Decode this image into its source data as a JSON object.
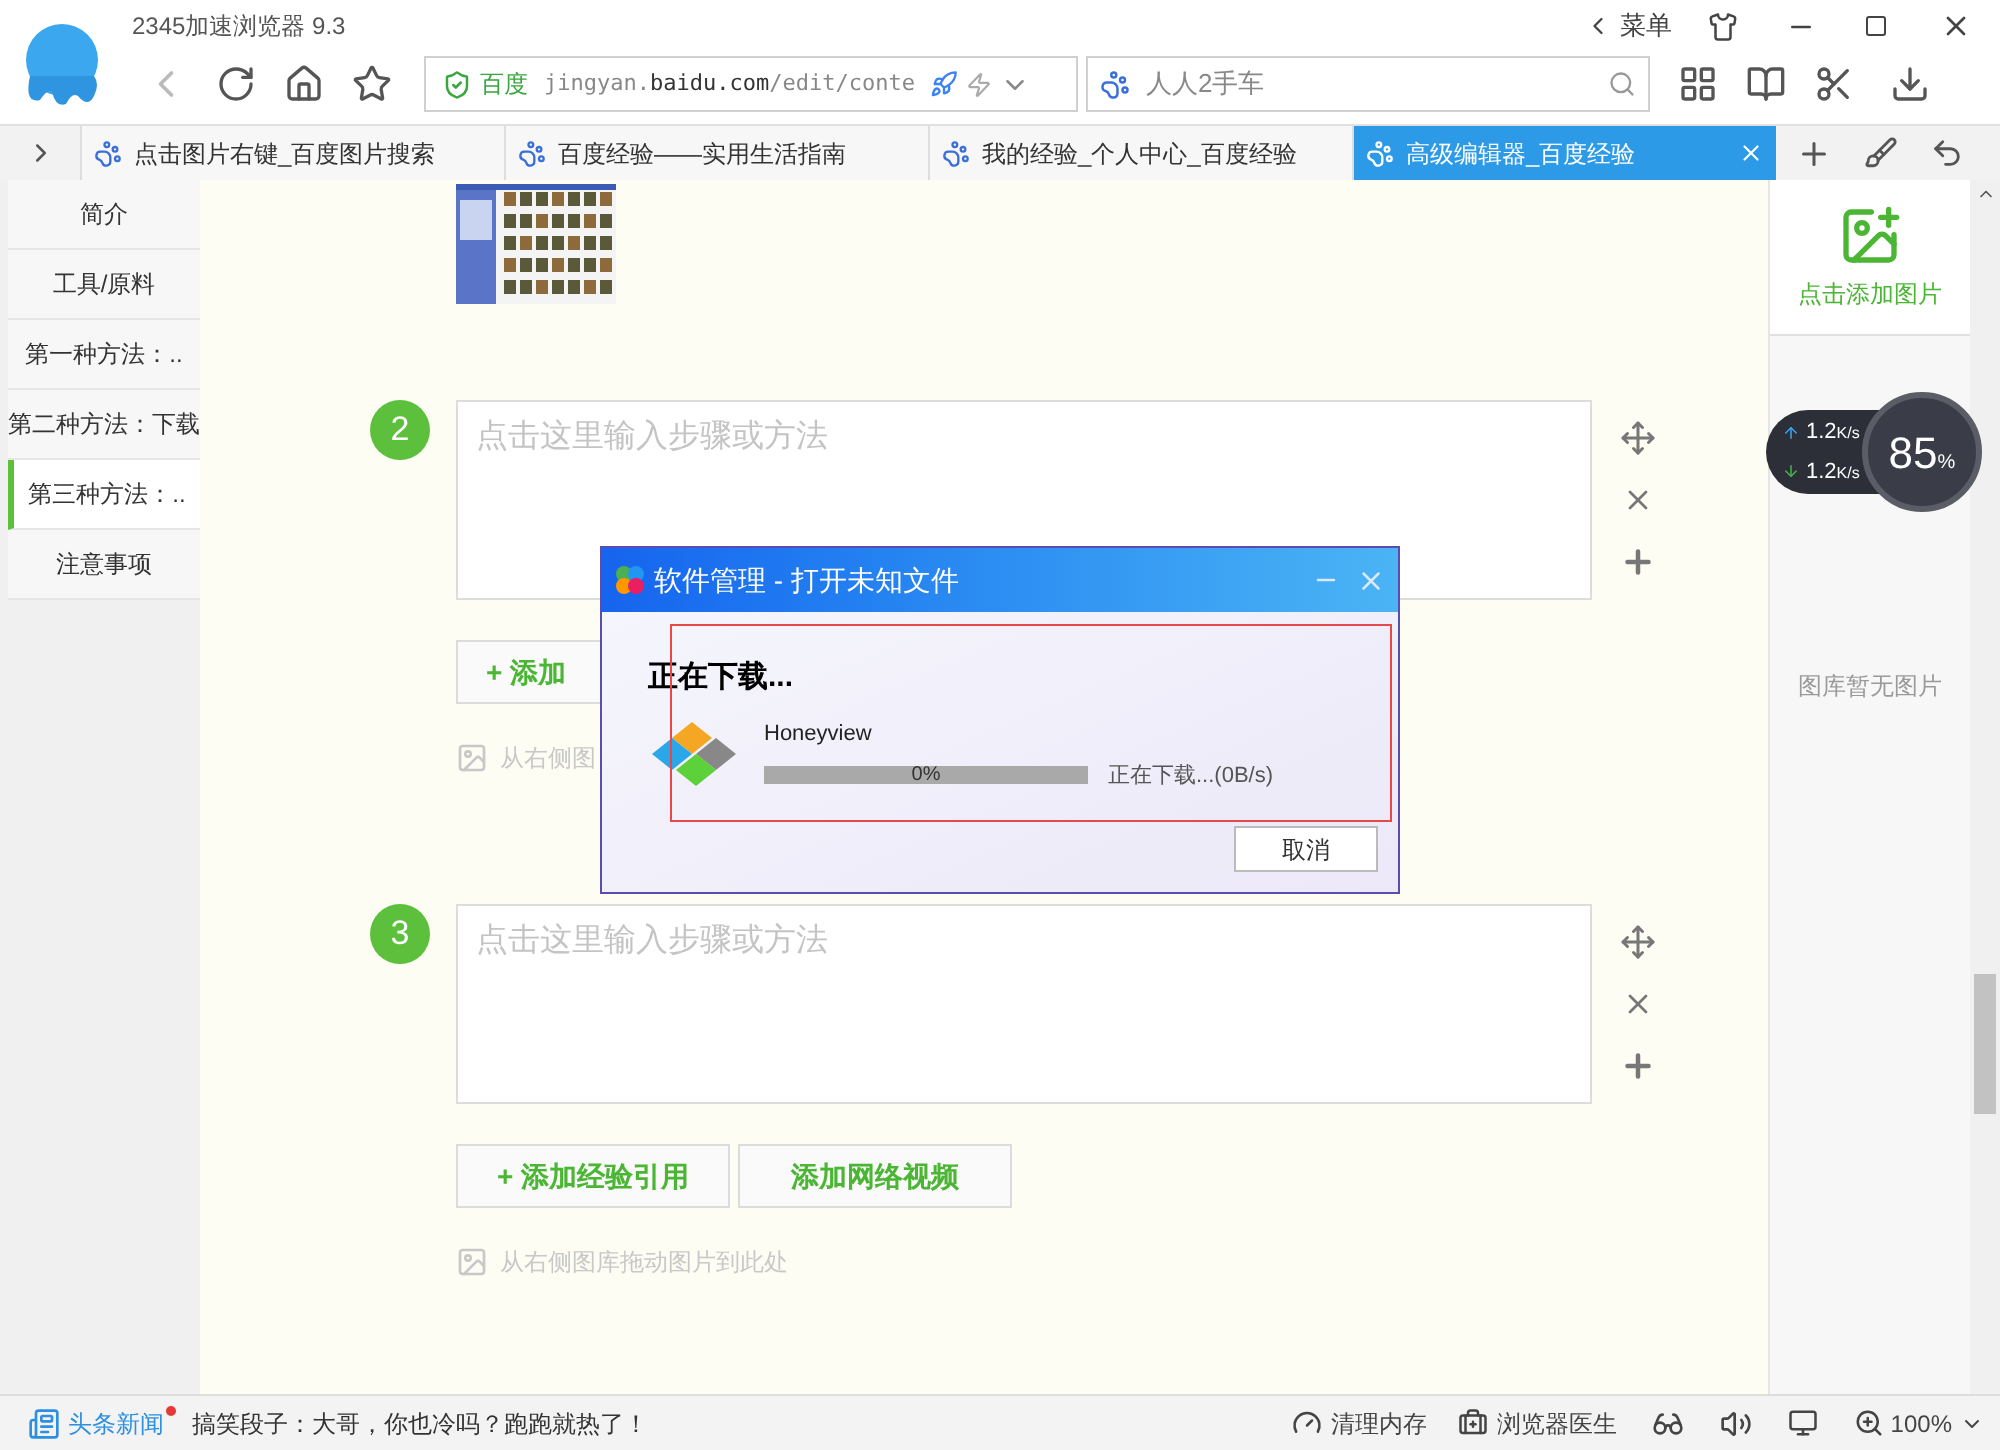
{
  "browser": {
    "title": "2345加速浏览器 9.3",
    "menu": "菜单",
    "address": {
      "site": "百度",
      "url": "jingyan.**baidu.com**/edit/conte"
    },
    "search": {
      "placeholder": "人人2手车"
    }
  },
  "tabs": [
    {
      "label": "点击图片右键_百度图片搜索",
      "selected": false
    },
    {
      "label": "百度经验——实用生活指南",
      "selected": false
    },
    {
      "label": "我的经验_个人中心_百度经验",
      "selected": false
    },
    {
      "label": "高级编辑器_百度经验",
      "selected": true
    }
  ],
  "sidebar": {
    "items": [
      {
        "label": "简介",
        "selected": false
      },
      {
        "label": "工具/原料",
        "selected": false
      },
      {
        "label": "第一种方法：..",
        "selected": false
      },
      {
        "label": "第二种方法：下载",
        "selected": false
      },
      {
        "label": "第三种方法：..",
        "selected": true
      },
      {
        "label": "注意事项",
        "selected": false
      }
    ]
  },
  "steps": [
    {
      "number": "2",
      "placeholder": "点击这里输入步骤或方法",
      "buttons": [
        {
          "label": "+ 添加"
        }
      ],
      "hint": "从右侧图"
    },
    {
      "number": "3",
      "placeholder": "点击这里输入步骤或方法",
      "buttons": [
        {
          "label": "+ 添加经验引用"
        },
        {
          "label": "添加网络视频"
        }
      ],
      "hint": "从右侧图库拖动图片到此处"
    }
  ],
  "picture_panel": {
    "add_label": "点击添加图片",
    "empty": "图库暂无图片"
  },
  "speed_widget": {
    "up": "1.2",
    "up_unit": "K/s",
    "down": "1.2",
    "down_unit": "K/s",
    "percent": "85",
    "percent_sign": "%"
  },
  "dialog": {
    "title": "软件管理 - 打开未知文件",
    "heading": "正在下载...",
    "app": "Honeyview",
    "progress": {
      "level": 0,
      "reading": "0%"
    },
    "status": "正在下载...(0B/s)",
    "cancel": "取消"
  },
  "status_bar": {
    "news": "头条新闻",
    "news_unread": true,
    "headline": "搞笑段子：大哥，你也冷吗？跑跑就热了！",
    "items": [
      "清理内存",
      "浏览器医生"
    ],
    "zoom": "100%"
  }
}
